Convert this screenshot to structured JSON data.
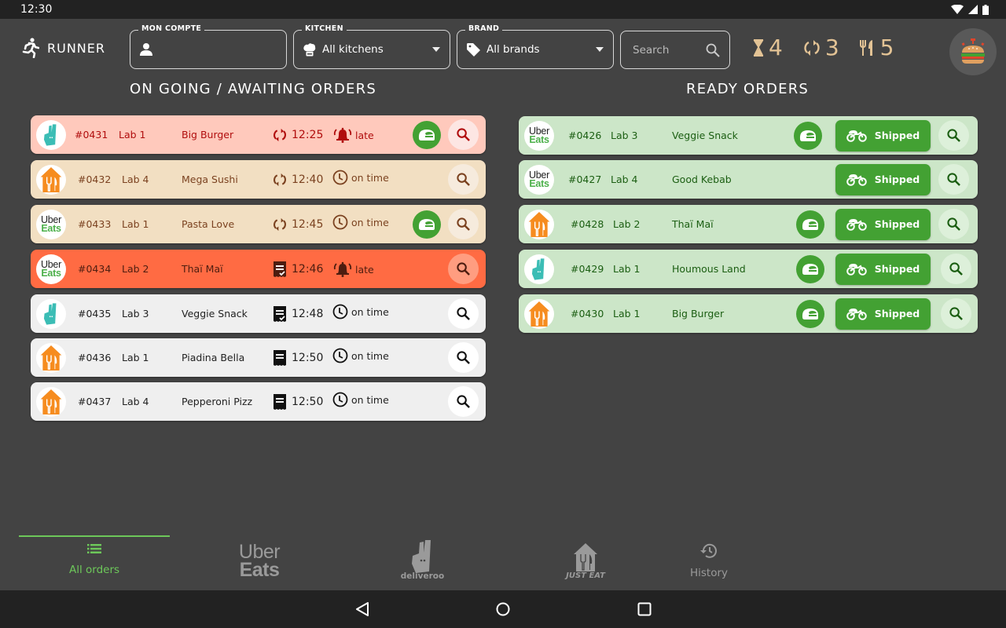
{
  "status_bar": {
    "time": "12:30"
  },
  "header": {
    "app_title": "RUNNER",
    "account": {
      "legend": "MON COMPTE",
      "value": ""
    },
    "kitchen": {
      "legend": "KITCHEN",
      "value": "All kitchens"
    },
    "brand": {
      "legend": "BRAND",
      "value": "All brands"
    },
    "search": {
      "placeholder": "Search"
    },
    "counters": {
      "awaiting": "4",
      "ongoing": "3",
      "ready": "5"
    }
  },
  "columns": {
    "ongoing_title": "ON GOING / AWAITING ORDERS",
    "ready_title": "READY ORDERS"
  },
  "ongoing_orders": [
    {
      "platform": "deliveroo",
      "number": "#0431",
      "kitchen": "Lab 1",
      "brand": "Big Burger",
      "status_icon": "refresh-icon",
      "time": "12:25",
      "timing_icon": "bell-icon",
      "timing": "late",
      "has_rider": true,
      "style": "late"
    },
    {
      "platform": "justeat",
      "number": "#0432",
      "kitchen": "Lab 4",
      "brand": "Mega Sushi",
      "status_icon": "refresh-icon",
      "time": "12:40",
      "timing_icon": "clock-icon",
      "timing": "on time",
      "has_rider": false,
      "style": "beige"
    },
    {
      "platform": "ubereats",
      "number": "#0433",
      "kitchen": "Lab 1",
      "brand": "Pasta Love",
      "status_icon": "refresh-icon",
      "time": "12:45",
      "timing_icon": "clock-icon",
      "timing": "on time",
      "has_rider": true,
      "style": "beige"
    },
    {
      "platform": "ubereats",
      "number": "#0434",
      "kitchen": "Lab 2",
      "brand": "Thaï Maï",
      "status_icon": "receipt-check-icon",
      "time": "12:46",
      "timing_icon": "bell-icon",
      "timing": "late",
      "has_rider": false,
      "style": "orange"
    },
    {
      "platform": "deliveroo",
      "number": "#0435",
      "kitchen": "Lab 3",
      "brand": "Veggie Snack",
      "status_icon": "receipt-check-icon",
      "time": "12:48",
      "timing_icon": "clock-icon",
      "timing": "on time",
      "has_rider": false,
      "style": "grey"
    },
    {
      "platform": "justeat",
      "number": "#0436",
      "kitchen": "Lab 1",
      "brand": "Piadina Bella",
      "status_icon": "receipt-icon",
      "time": "12:50",
      "timing_icon": "clock-icon",
      "timing": "on time",
      "has_rider": false,
      "style": "grey"
    },
    {
      "platform": "justeat",
      "number": "#0437",
      "kitchen": "Lab 4",
      "brand": "Pepperoni Pizz",
      "status_icon": "receipt-icon",
      "time": "12:50",
      "timing_icon": "clock-icon",
      "timing": "on time",
      "has_rider": false,
      "style": "grey"
    }
  ],
  "ready_orders": [
    {
      "platform": "ubereats",
      "number": "#0426",
      "kitchen": "Lab 3",
      "brand": "Veggie Snack",
      "has_rider": true,
      "action": "Shipped"
    },
    {
      "platform": "ubereats",
      "number": "#0427",
      "kitchen": "Lab 4",
      "brand": "Good Kebab",
      "has_rider": false,
      "action": "Shipped"
    },
    {
      "platform": "justeat",
      "number": "#0428",
      "kitchen": "Lab 2",
      "brand": "Thaï Maï",
      "has_rider": true,
      "action": "Shipped"
    },
    {
      "platform": "deliveroo",
      "number": "#0429",
      "kitchen": "Lab 1",
      "brand": "Houmous Land",
      "has_rider": true,
      "action": "Shipped"
    },
    {
      "platform": "justeat",
      "number": "#0430",
      "kitchen": "Lab 1",
      "brand": "Big Burger",
      "has_rider": true,
      "action": "Shipped"
    }
  ],
  "bottom_nav": {
    "all_orders": "All orders",
    "ubereats_line1": "Uber",
    "ubereats_line2": "Eats",
    "deliveroo": "deliveroo",
    "justeat": "JUST EAT",
    "history": "History"
  },
  "logos": {
    "uber": "Uber",
    "eats": "Eats"
  },
  "colors": {
    "accent_green": "#43a133",
    "nav_active": "#6dc85a",
    "late_bg": "#ffc9bc",
    "urgent_bg": "#ff6b43",
    "ongoing_bg": "#f2dfc2",
    "awaiting_bg": "#efefef",
    "ready_bg": "#cce6c8",
    "counter_color": "#e3c395",
    "deliveroo": "#3bbdb5",
    "justeat": "#f68c1f",
    "ubereats_green": "#4cb04a"
  }
}
